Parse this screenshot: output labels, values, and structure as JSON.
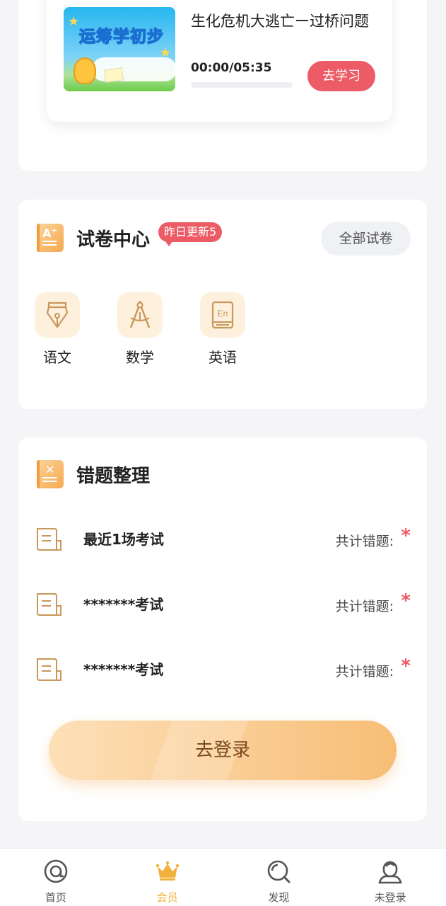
{
  "course": {
    "thumbnail_text": "运筹学初步",
    "title": "生化危机大逃亡ー过桥问题",
    "time": "00:00/05:35",
    "progress": 0,
    "study_button": "去学习"
  },
  "exam_center": {
    "title": "试卷中心",
    "badge": "昨日更新5",
    "all_button": "全部试卷",
    "subjects": [
      {
        "label": "语文",
        "icon": "fountain-pen-icon"
      },
      {
        "label": "数学",
        "icon": "compass-icon"
      },
      {
        "label": "英语",
        "icon": "english-book-icon"
      }
    ]
  },
  "wrong_questions": {
    "title": "错题整理",
    "rows": [
      {
        "title": "最近1场考试",
        "count_label": "共计错题:",
        "count": "*"
      },
      {
        "title": "*******考试",
        "count_label": "共计错题:",
        "count": "*"
      },
      {
        "title": "*******考试",
        "count_label": "共计错题:",
        "count": "*"
      }
    ],
    "login_button": "去登录"
  },
  "bottom_nav": {
    "items": [
      {
        "label": "首页",
        "icon": "home-icon",
        "active": false
      },
      {
        "label": "会员",
        "icon": "crown-icon",
        "active": true
      },
      {
        "label": "发现",
        "icon": "discover-icon",
        "active": false
      },
      {
        "label": "未登录",
        "icon": "user-icon",
        "active": false
      }
    ]
  },
  "colors": {
    "accent_red": "#ec5b66",
    "accent_orange": "#f7bd76",
    "active_nav": "#f0b23c"
  }
}
